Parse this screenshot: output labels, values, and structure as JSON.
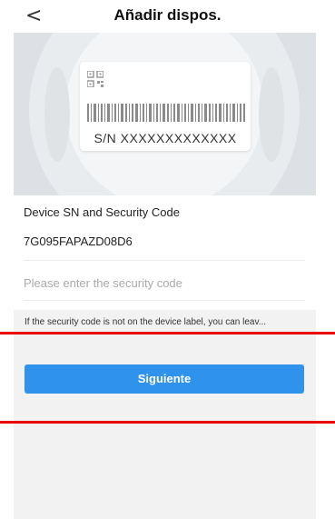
{
  "header": {
    "back_icon": "<",
    "title": "Añadir dispos."
  },
  "illustration": {
    "sn_text": "S/N  XXXXXXXXXXXXX",
    "icon": "device-label-image"
  },
  "form": {
    "section_label": "Device SN and Security Code",
    "serial_number": "7G095FAPAZD08D6",
    "security_code_value": "",
    "security_code_placeholder": "Please enter the security code"
  },
  "note": "If the security code is not on the device label, you can leav...",
  "actions": {
    "next_label": "Siguiente"
  },
  "colors": {
    "button": "#2f93ee",
    "highlight": "#e80000",
    "panel": "#f2f2f2"
  }
}
